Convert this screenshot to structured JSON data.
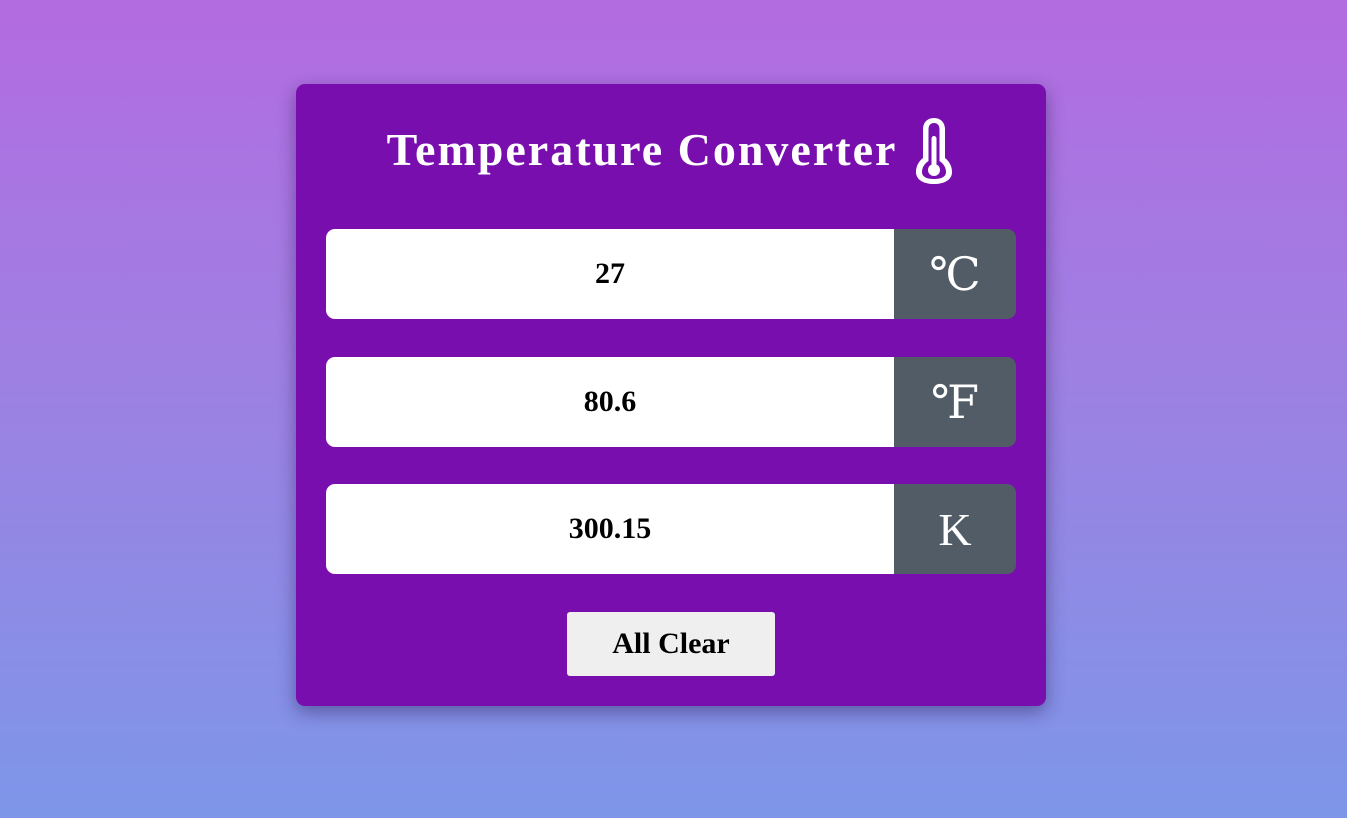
{
  "app": {
    "title": "Temperature Converter",
    "title_icon": "thermometer-icon"
  },
  "fields": [
    {
      "value": "27",
      "unit": "℃",
      "unit_name": "celsius"
    },
    {
      "value": "80.6",
      "unit": "℉",
      "unit_name": "fahrenheit"
    },
    {
      "value": "300.15",
      "unit": "K",
      "unit_name": "kelvin"
    }
  ],
  "actions": {
    "clear_label": "All Clear"
  },
  "colors": {
    "card_bg": "#790eaf",
    "unit_bg": "#525c66",
    "button_bg": "#efefef",
    "gradient_top": "#b36be0",
    "gradient_bottom": "#7d96e8"
  }
}
